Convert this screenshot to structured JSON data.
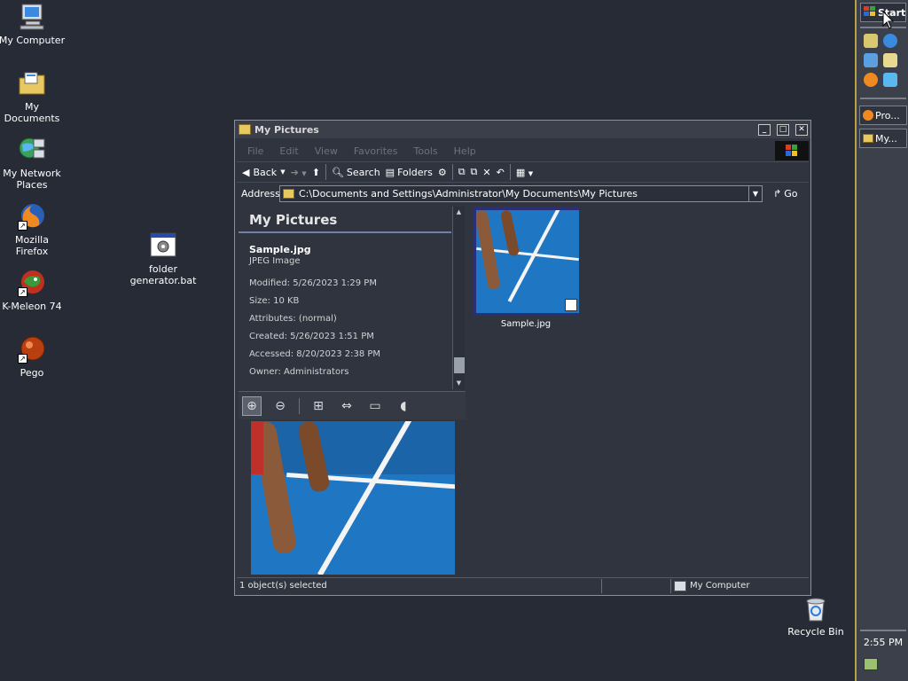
{
  "desktop": {
    "icons": [
      {
        "label": "My Computer",
        "icon": "my-computer-icon"
      },
      {
        "label": "My Documents",
        "icon": "my-documents-icon"
      },
      {
        "label": "My Network Places",
        "icon": "network-places-icon"
      },
      {
        "label": "Mozilla Firefox",
        "icon": "firefox-icon"
      },
      {
        "label": "K-Meleon 74",
        "icon": "k-meleon-icon"
      },
      {
        "label": "Pego",
        "icon": "pego-icon"
      },
      {
        "label": "folder generator.bat",
        "icon": "batch-file-icon"
      },
      {
        "label": "Recycle Bin",
        "icon": "recycle-bin-icon"
      }
    ]
  },
  "taskbar": {
    "start_label": "Start",
    "tasks": [
      {
        "label": "Pro..."
      },
      {
        "label": "My..."
      }
    ],
    "clock": "2:55 PM"
  },
  "window": {
    "title": "My Pictures",
    "menu": [
      "File",
      "Edit",
      "View",
      "Favorites",
      "Tools",
      "Help"
    ],
    "toolbar": {
      "back": "Back",
      "search": "Search",
      "folders": "Folders"
    },
    "address": {
      "label": "Address",
      "value": "C:\\Documents and Settings\\Administrator\\My Documents\\My Pictures",
      "go": "Go"
    },
    "details": {
      "heading": "My Pictures",
      "filename": "Sample.jpg",
      "type": "JPEG Image",
      "modified": "Modified: 5/26/2023 1:29 PM",
      "size": "Size: 10 KB",
      "attributes": "Attributes: (normal)",
      "created": "Created: 5/26/2023 1:51 PM",
      "accessed": "Accessed: 8/20/2023 2:38 PM",
      "owner": "Owner: Administrators"
    },
    "files": [
      {
        "name": "Sample.jpg"
      }
    ],
    "status": {
      "selection": "1 object(s) selected",
      "location": "My Computer"
    }
  },
  "colors": {
    "desktop": "#262b36",
    "window": "#2f343f",
    "track_blue": "#1f77c4",
    "taskbar_border": "#b8a046"
  }
}
